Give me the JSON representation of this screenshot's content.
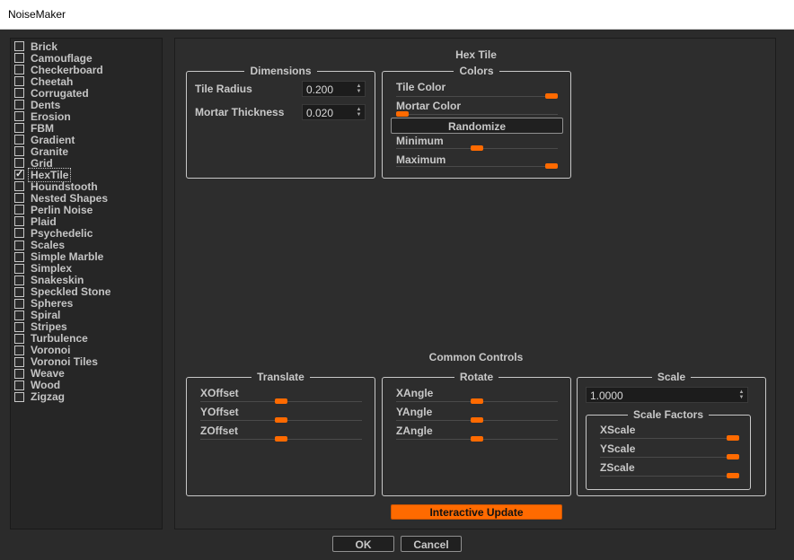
{
  "window": {
    "title": "NoiseMaker"
  },
  "noise_list": {
    "items": [
      {
        "label": "Brick",
        "checked": false
      },
      {
        "label": "Camouflage",
        "checked": false
      },
      {
        "label": "Checkerboard",
        "checked": false
      },
      {
        "label": "Cheetah",
        "checked": false
      },
      {
        "label": "Corrugated",
        "checked": false
      },
      {
        "label": "Dents",
        "checked": false
      },
      {
        "label": "Erosion",
        "checked": false
      },
      {
        "label": "FBM",
        "checked": false
      },
      {
        "label": "Gradient",
        "checked": false
      },
      {
        "label": "Granite",
        "checked": false
      },
      {
        "label": "Grid",
        "checked": false
      },
      {
        "label": "HexTile",
        "checked": true
      },
      {
        "label": "Houndstooth",
        "checked": false
      },
      {
        "label": "Nested Shapes",
        "checked": false
      },
      {
        "label": "Perlin Noise",
        "checked": false
      },
      {
        "label": "Plaid",
        "checked": false
      },
      {
        "label": "Psychedelic",
        "checked": false
      },
      {
        "label": "Scales",
        "checked": false
      },
      {
        "label": "Simple Marble",
        "checked": false
      },
      {
        "label": "Simplex",
        "checked": false
      },
      {
        "label": "Snakeskin",
        "checked": false
      },
      {
        "label": "Speckled Stone",
        "checked": false
      },
      {
        "label": "Spheres",
        "checked": false
      },
      {
        "label": "Spiral",
        "checked": false
      },
      {
        "label": "Stripes",
        "checked": false
      },
      {
        "label": "Turbulence",
        "checked": false
      },
      {
        "label": "Voronoi",
        "checked": false
      },
      {
        "label": "Voronoi Tiles",
        "checked": false
      },
      {
        "label": "Weave",
        "checked": false
      },
      {
        "label": "Wood",
        "checked": false
      },
      {
        "label": "Zigzag",
        "checked": false
      }
    ]
  },
  "hex_tile": {
    "title": "Hex Tile",
    "dimensions": {
      "legend": "Dimensions",
      "tile_radius_label": "Tile Radius",
      "tile_radius_value": "0.200",
      "mortar_thickness_label": "Mortar Thickness",
      "mortar_thickness_value": "0.020"
    },
    "colors": {
      "legend": "Colors",
      "tile_color_label": "Tile Color",
      "tile_color_level": 1.0,
      "mortar_color_label": "Mortar Color",
      "mortar_color_level": 0.0,
      "randomize_label": "Randomize",
      "minimum_label": "Minimum",
      "minimum_level": 0.5,
      "maximum_label": "Maximum",
      "maximum_level": 1.0
    }
  },
  "common": {
    "title": "Common Controls",
    "translate": {
      "legend": "Translate",
      "sliders": [
        {
          "label": "XOffset",
          "level": 0.5
        },
        {
          "label": "YOffset",
          "level": 0.5
        },
        {
          "label": "ZOffset",
          "level": 0.5
        }
      ]
    },
    "rotate": {
      "legend": "Rotate",
      "sliders": [
        {
          "label": "XAngle",
          "level": 0.5
        },
        {
          "label": "YAngle",
          "level": 0.5
        },
        {
          "label": "ZAngle",
          "level": 0.5
        }
      ]
    },
    "scale": {
      "legend": "Scale",
      "value": "1.0000",
      "factors_legend": "Scale Factors",
      "sliders": [
        {
          "label": "XScale",
          "level": 1.0
        },
        {
          "label": "YScale",
          "level": 1.0
        },
        {
          "label": "ZScale",
          "level": 1.0
        }
      ]
    }
  },
  "interactive_update_label": "Interactive Update",
  "ok_label": "OK",
  "cancel_label": "Cancel",
  "accent_color": "#ff6a00"
}
